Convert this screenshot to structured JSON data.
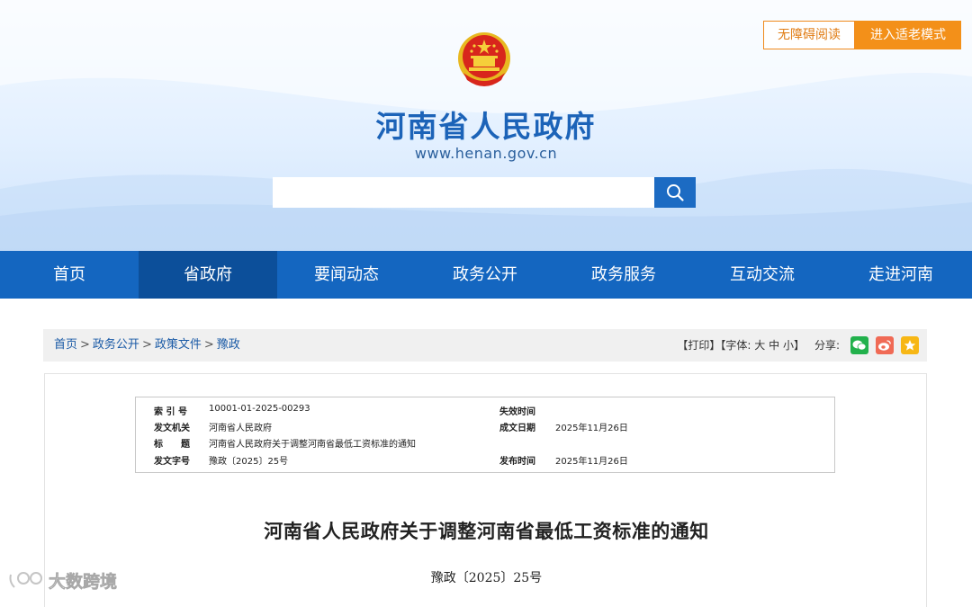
{
  "header": {
    "accessibility_label": "无障碍阅读",
    "elder_mode_label": "进入适老模式",
    "site_title": "河南省人民政府",
    "site_url": "www.henan.gov.cn",
    "search": {
      "placeholder": ""
    },
    "colors": {
      "brand_blue": "#1466c0",
      "accent_orange": "#f39019"
    }
  },
  "nav": {
    "items": [
      "首页",
      "省政府",
      "要闻动态",
      "政务公开",
      "政务服务",
      "互动交流",
      "走进河南"
    ],
    "active_index": 1
  },
  "breadcrumb": {
    "items": [
      "首页",
      "政务公开",
      "政策文件",
      "豫政"
    ],
    "separator": ">"
  },
  "tools": {
    "print_label": "【打印】",
    "font_label": "【字体:",
    "font_large": "大",
    "font_medium": "中",
    "font_small": "小",
    "font_end": "】",
    "share_label": "分享:",
    "share_icons": [
      "wechat-icon",
      "weibo-icon",
      "favorite-star-icon"
    ]
  },
  "meta": {
    "index_no_label": "索 引 号",
    "index_no": "10001-01-2025-00293",
    "issuer_label": "发文机关",
    "issuer": "河南省人民政府",
    "title_label": "标　　题",
    "title": "河南省人民政府关于调整河南省最低工资标准的通知",
    "doc_no_label": "发文字号",
    "doc_no": "豫政〔2025〕25号",
    "expire_label": "失效时间",
    "expire": "",
    "created_label": "成文日期",
    "created": "2025年11月26日",
    "published_label": "发布时间",
    "published": "2025年11月26日"
  },
  "document": {
    "title": "河南省人民政府关于调整河南省最低工资标准的通知",
    "number": "豫政〔2025〕25号"
  },
  "watermark": {
    "text": "大数跨境"
  }
}
